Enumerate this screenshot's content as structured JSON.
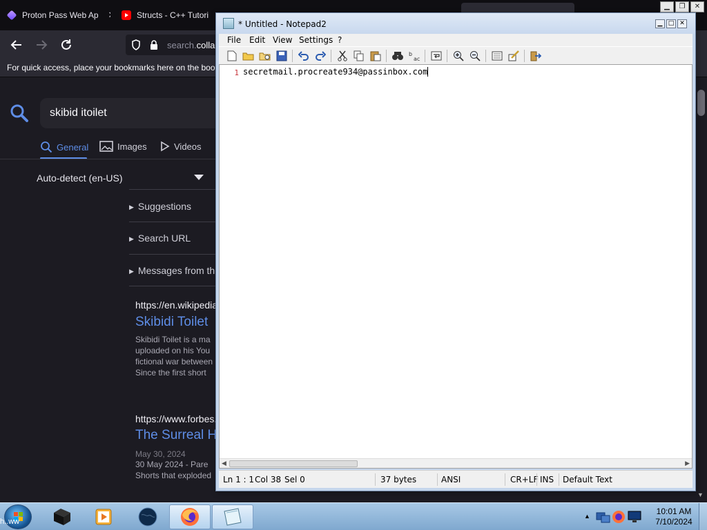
{
  "browser": {
    "tabs": [
      {
        "label": "Proton Pass Web Ap",
        "icon": "proton-pass-icon",
        "color": "#8a6cf0"
      },
      {
        "label": "Structs - C++ Tutori",
        "icon": "youtube-icon",
        "color": "#ff0000"
      }
    ],
    "url_host": "search.",
    "url_rest": "colla",
    "bookmarks_hint": "For quick access, place your bookmarks here on the book",
    "search_query": "skibid itoilet",
    "search_tabs": [
      "General",
      "Images",
      "Videos"
    ],
    "language": "Auto-detect (en-US)",
    "accordions": [
      "Suggestions",
      "Search URL",
      "Messages from th"
    ],
    "results": [
      {
        "url": "https://en.wikipedia",
        "title": "Skibidi Toilet",
        "lines": [
          "Skibidi Toilet is a ma",
          "uploaded on his You",
          "fictional war between",
          "Since the first short"
        ]
      },
      {
        "url": "https://www.forbes.",
        "title": "The Surreal H",
        "lines": [
          "May 30, 2024",
          "30 May 2024 - Pare",
          "Shorts that exploded"
        ]
      }
    ]
  },
  "notepad": {
    "title": "* Untitled - Notepad2",
    "menu": [
      "File",
      "Edit",
      "View",
      "Settings",
      "?"
    ],
    "line_number": "1",
    "content": "secretmail.procreate934@passinbox.com",
    "status": {
      "position": "Ln 1 : 1",
      "col": "Col 38",
      "sel": "Sel 0",
      "size": "37 bytes",
      "encoding": "ANSI",
      "eol": "CR+LF",
      "mode": "INS",
      "scheme": "Default Text"
    }
  },
  "taskbar": {
    "time": "10:01 AM",
    "date": "7/10/2024",
    "corner_hint": "h..ww"
  }
}
